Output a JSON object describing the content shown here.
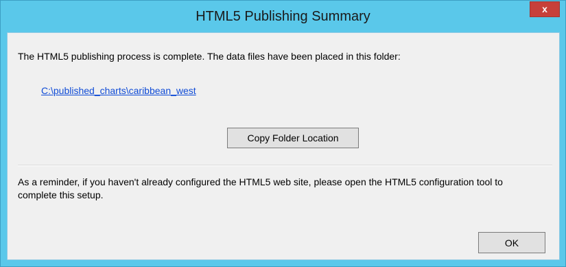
{
  "window": {
    "title": "HTML5 Publishing Summary",
    "close_label": "x"
  },
  "content": {
    "message": "The HTML5 publishing process is complete. The data files have been placed in this folder:",
    "folder_link": "C:\\published_charts\\caribbean_west",
    "copy_button_label": "Copy Folder Location",
    "reminder": "As a reminder, if you haven't already configured the HTML5 web site, please open the HTML5 configuration tool to complete this setup."
  },
  "footer": {
    "ok_label": "OK"
  },
  "colors": {
    "titlebar": "#5ac8ea",
    "close_button": "#c7403a",
    "link": "#0f4bd6",
    "client_background": "#f0f0f0"
  }
}
